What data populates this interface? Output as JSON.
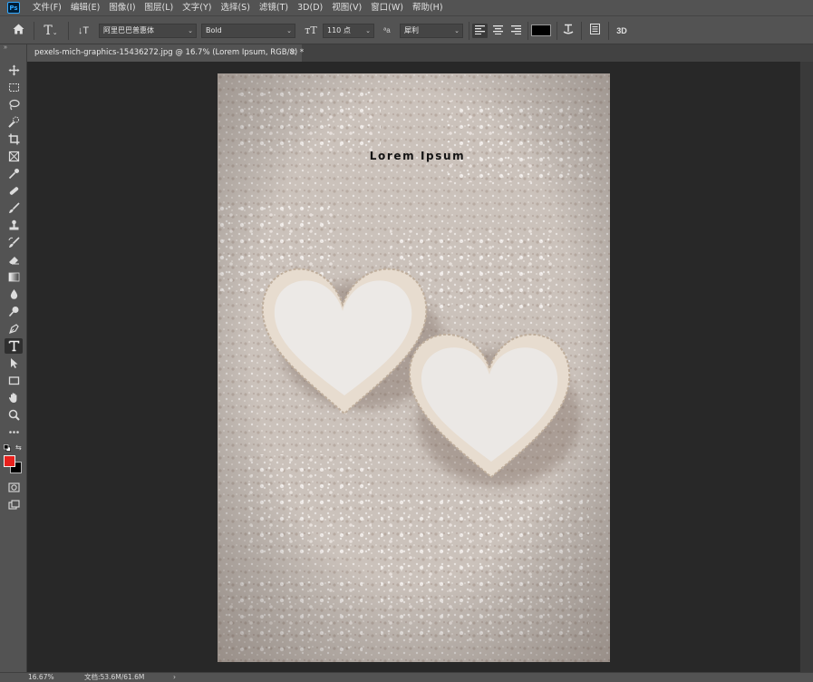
{
  "app": {
    "logo_text": "Ps"
  },
  "menu": [
    "文件(F)",
    "编辑(E)",
    "图像(I)",
    "图层(L)",
    "文字(Y)",
    "选择(S)",
    "滤镜(T)",
    "3D(D)",
    "视图(V)",
    "窗口(W)",
    "帮助(H)"
  ],
  "options": {
    "font_family": "阿里巴巴普惠体",
    "font_style": "Bold",
    "font_size": "110 点",
    "antialias_label": "ªa",
    "antialias_value": "犀利",
    "text_color": "#000000",
    "three_d_label": "3D"
  },
  "document": {
    "tab_title": "pexels-mich-graphics-15436272.jpg @ 16.7% (Lorem Ipsum, RGB/8) *",
    "close_glyph": "×",
    "canvas_text": "Lorem Ipsum"
  },
  "colors": {
    "foreground": "#e8211d",
    "background": "#000000"
  },
  "tools": [
    "move-tool",
    "marquee-tool",
    "lasso-tool",
    "quick-select-tool",
    "crop-tool",
    "frame-tool",
    "eyedropper-tool",
    "healing-brush-tool",
    "brush-tool",
    "clone-stamp-tool",
    "history-brush-tool",
    "eraser-tool",
    "gradient-tool",
    "blur-tool",
    "dodge-tool",
    "pen-tool",
    "type-tool",
    "path-select-tool",
    "rectangle-tool",
    "hand-tool",
    "zoom-tool",
    "more-tools"
  ],
  "status": {
    "zoom": "16.67%",
    "doc_size": "文档:53.6M/61.6M",
    "arrow": "›"
  }
}
